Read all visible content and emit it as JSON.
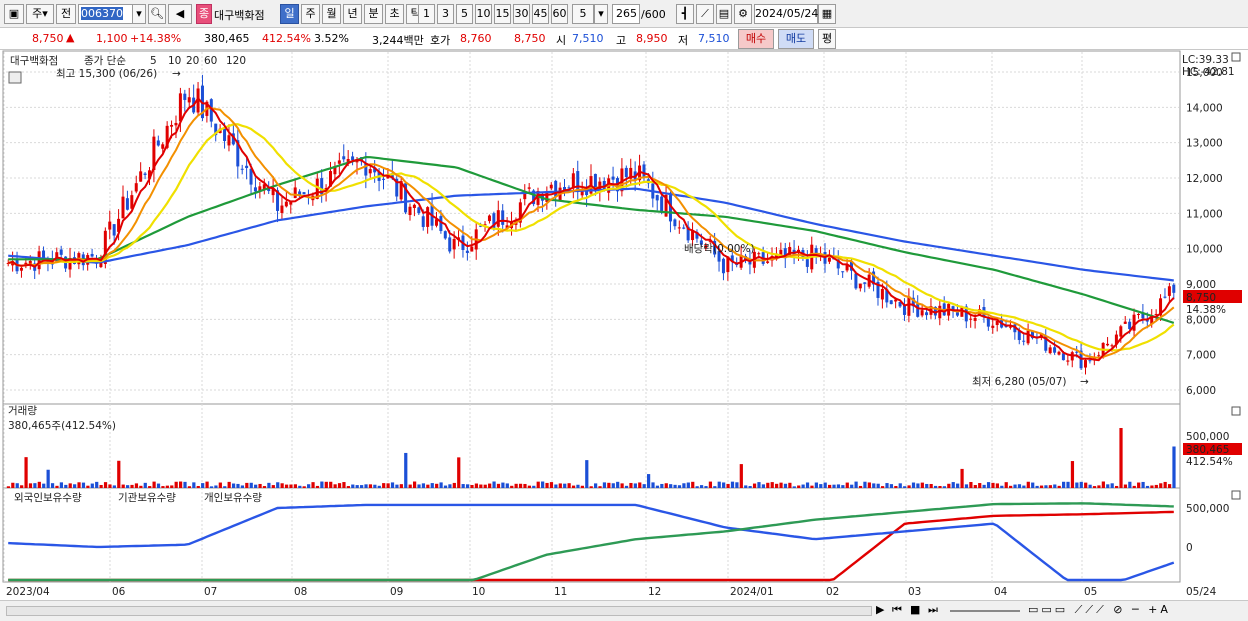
{
  "toolbar": {
    "market_label": "주",
    "type_label": "전",
    "code": "006370",
    "stock_name": "대구백화점",
    "stock_badge": "종",
    "periods": [
      {
        "label": "일",
        "active": true
      },
      {
        "label": "주",
        "active": false
      },
      {
        "label": "월",
        "active": false
      },
      {
        "label": "년",
        "active": false
      },
      {
        "label": "분",
        "active": false
      },
      {
        "label": "초",
        "active": false
      },
      {
        "label": "틱",
        "active": false
      }
    ],
    "intervals": [
      "1",
      "3",
      "5",
      "10",
      "15",
      "30",
      "45",
      "60"
    ],
    "interval_value": "5",
    "bar_count": "265",
    "bar_max": "/600",
    "date": "2024/05/24"
  },
  "quote": {
    "price": "8,750",
    "change": "1,100",
    "change_pct": "+14.38%",
    "volume": "380,465",
    "volume_pct": "412.54%",
    "turnover_pct": "3.52%",
    "amount": "3,244백만",
    "ask_label": "호가",
    "ask": "8,760",
    "bid": "8,750",
    "open_label": "시",
    "open": "7,510",
    "high_label": "고",
    "high": "8,950",
    "low_label": "저",
    "low": "7,510",
    "buy_label": "매수",
    "sell_label": "매도",
    "eval_label": "평"
  },
  "price_panel": {
    "title": "대구백화점",
    "ma_label": "종가 단순",
    "ma_periods": [
      "5",
      "10",
      "20",
      "60",
      "120"
    ],
    "lc": "LC:39.33",
    "hc": "HC:-42.81",
    "high_note": "최고 15,300 (06/26)",
    "low_note": "최저 6,280 (05/07)",
    "dividend_note": "배당락(0.00%)",
    "price_tag": "8,750",
    "pct_tag": "14.38%",
    "y_ticks": [
      "15,000",
      "14,000",
      "13,000",
      "12,000",
      "11,000",
      "10,000",
      "9,000",
      "8,000",
      "7,000",
      "6,000"
    ]
  },
  "volume_panel": {
    "title": "거래량",
    "value": "380,465주(412.54%)",
    "y_tick": "500,000",
    "tag_value": "380,465",
    "tag_pct": "412.54%"
  },
  "holding_panel": {
    "labels": [
      "외국인보유수량",
      "기관보유수량",
      "개인보유수량"
    ],
    "y_ticks": [
      "500,000",
      "0"
    ]
  },
  "x_axis": [
    "2023/04",
    "06",
    "07",
    "08",
    "09",
    "10",
    "11",
    "12",
    "2024/01",
    "02",
    "03",
    "04",
    "05",
    "05/24"
  ],
  "colors": {
    "up": "#e00000",
    "down": "#1b4fd6",
    "ma5": "#e00000",
    "ma10": "#f39000",
    "ma20": "#f0e000",
    "ma60": "#1f9a3a",
    "ma120": "#2a56e6",
    "foreign": "#e00000",
    "institution": "#2a56e6",
    "individual": "#2e9a55"
  },
  "chart_data": {
    "type": "candlestick",
    "title": "대구백화점",
    "y_range": [
      6000,
      15300
    ],
    "dates": [
      "2023/04",
      "06",
      "07",
      "08",
      "09",
      "10",
      "11",
      "12",
      "2024/01",
      "02",
      "03",
      "04",
      "05",
      "05/24"
    ],
    "close": [
      9600,
      9800,
      14500,
      11200,
      12500,
      10000,
      11800,
      12100,
      9500,
      9800,
      8400,
      8000,
      6800,
      8750
    ],
    "ma60": [
      9700,
      9700,
      10900,
      11800,
      12600,
      12300,
      11400,
      11100,
      10900,
      10500,
      9900,
      9400,
      8700,
      7900
    ],
    "ma120": [
      9800,
      9600,
      10100,
      10800,
      11200,
      11500,
      11600,
      11700,
      11300,
      10700,
      10200,
      9800,
      9400,
      9100
    ],
    "volume_peak": 550000,
    "series": [
      {
        "name": "외국인보유수량",
        "values": [
          -700000,
          -680000,
          -660000,
          -650000,
          -600000,
          -620000,
          -700000,
          -690000,
          -650000,
          -600000,
          300000,
          400000,
          420000,
          450000
        ]
      },
      {
        "name": "기관보유수량",
        "values": [
          50000,
          0,
          30000,
          500000,
          540000,
          540000,
          540000,
          540000,
          250000,
          100000,
          200000,
          300000,
          -600000,
          -200000
        ]
      },
      {
        "name": "개인보유수량",
        "values": [
          -600000,
          -600000,
          -620000,
          -620000,
          -650000,
          -500000,
          -100000,
          100000,
          200000,
          350000,
          450000,
          550000,
          560000,
          520000
        ]
      }
    ]
  }
}
